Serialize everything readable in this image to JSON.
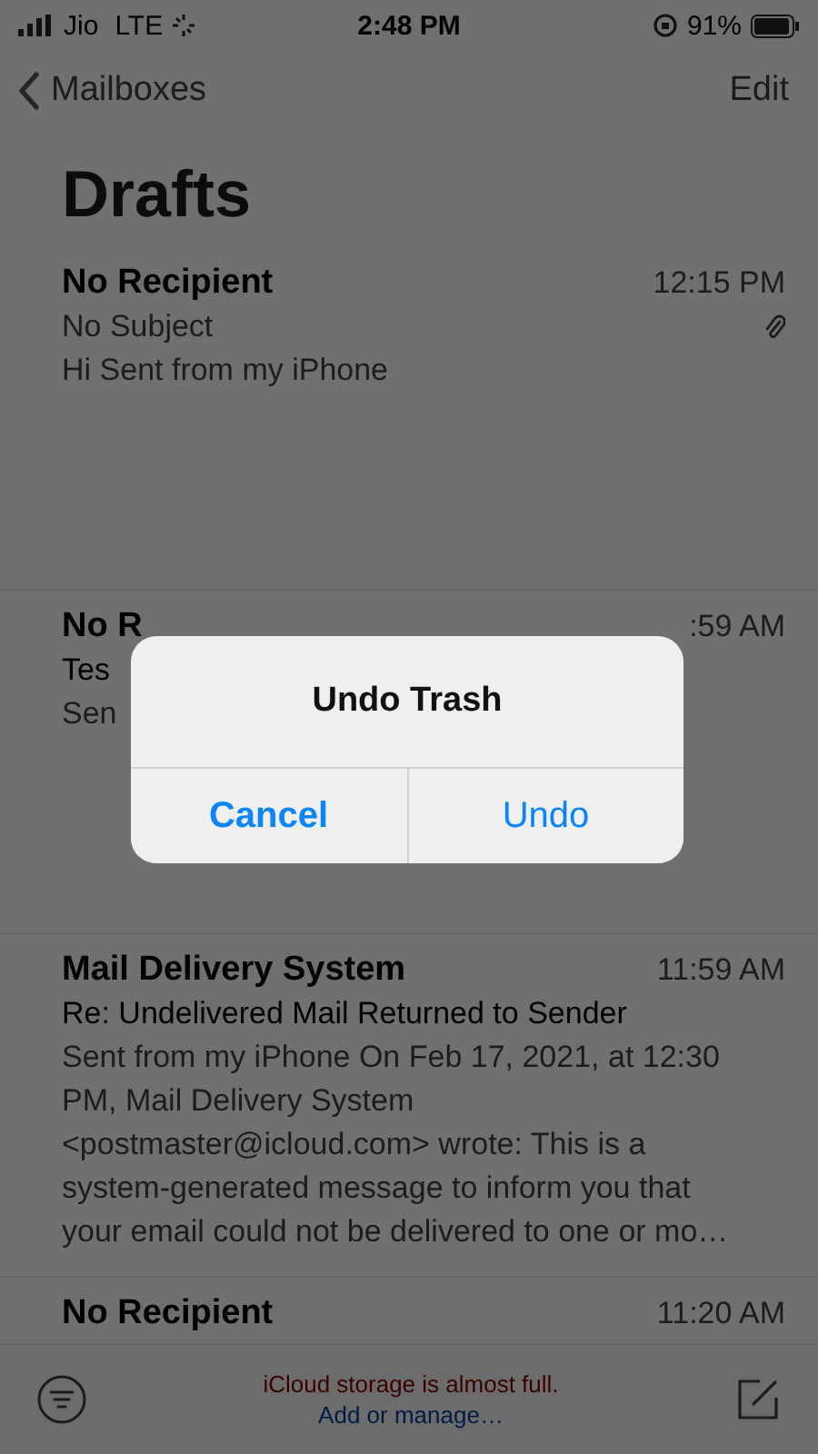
{
  "status_bar": {
    "carrier": "Jio",
    "network": "LTE",
    "time": "2:48 PM",
    "battery": "91%"
  },
  "nav": {
    "back": "Mailboxes",
    "edit": "Edit"
  },
  "title": "Drafts",
  "messages": [
    {
      "sender": "No Recipient",
      "time": "12:15 PM",
      "subject": "No Subject",
      "subject_dim": true,
      "preview": "Hi Sent from my iPhone",
      "has_attachment": true
    },
    {
      "sender": "No R",
      "time": ":59 AM",
      "subject": "Tes",
      "subject_dim": false,
      "preview": "Sen",
      "has_attachment": false
    },
    {
      "sender": "Mail Delivery System",
      "time": "11:59 AM",
      "subject": "Re: Undelivered Mail Returned to Sender",
      "subject_dim": false,
      "preview": "Sent from my iPhone On Feb 17, 2021, at 12:30 PM, Mail Delivery System <postmaster@icloud.com> wrote: This is a system-generated message to inform you that your email could not be delivered to one or mo…",
      "has_attachment": false
    },
    {
      "sender": "No Recipient",
      "time": "11:20 AM",
      "has_attachment": false
    }
  ],
  "toolbar": {
    "warning": "iCloud storage is almost full.",
    "link": "Add or manage…"
  },
  "alert": {
    "title": "Undo Trash",
    "buttons": [
      {
        "label": "Cancel",
        "bold": true
      },
      {
        "label": "Undo",
        "bold": false
      }
    ]
  }
}
